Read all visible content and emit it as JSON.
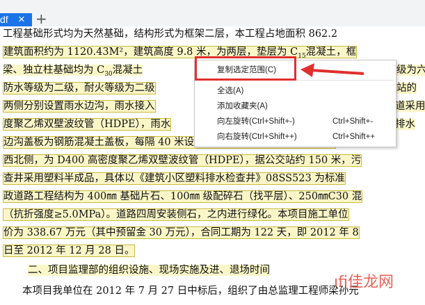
{
  "tab": {
    "label": "df",
    "close": "×",
    "new": "+"
  },
  "document": {
    "lines": [
      "工程基础形式均为天然基础，结构形式为框架二层，本工程占地面积 862.2",
      "建筑面积约为 1120.43M²，建筑高度 9.8 米，为两层，垫层为 C",
      "梁、独立柱基础均为 C",
      "防水等级为二级，耐火等级为二级",
      "两侧分别设置雨水边沟，雨水接入",
      "度聚乙烯双壁波纹管（HDPE），雨水",
      "边沟盖板为钢筋混凝土盖板，每隔 40 米设置伸缩缝一道；污水管道设置在",
      "西北侧，为 D400 高密度聚乙烯双壁波纹管（HDPE），据公交站约 150 米，污",
      "查井采用塑料半成品，具体以《建筑小区塑料排水检查井》08SS523 为标准",
      "政道路工程结构为 400㎜ 基础片石、100㎜ 级配碎石（找平层）、250㎜C30 混",
      "（抗折强度≥5.0MPa）。道路四周安装侧石，之内进行绿化。本项目施工单位",
      "价为 338.67 万元（其中预留金 30 万元），合同工期为 122 天，即 2012 年 8",
      "日至 2012 年 12 月 28 日。",
      "二、项目监理部的组织设施、现场实施及进、退场时间",
      "本项目我单位在 2012 年 7 月 27 日中标后，组织了由总监理工程师梁孙元"
    ],
    "fragments": {
      "sub15": "15",
      "tail1": "混凝土，框",
      "sub30": "30",
      "tail2": "混凝土",
      "tail2b": "级为六",
      "tail3": "站的",
      "tail4": "道采用",
      "tail5": "排水"
    }
  },
  "context_menu": {
    "items": [
      {
        "label": "复制选定范围(C)",
        "shortcut": ""
      },
      {
        "label": "全选(A)",
        "shortcut": ""
      },
      {
        "label": "添加收藏夹(A)",
        "shortcut": ""
      },
      {
        "label": "向左旋转(Ctrl+Shift+-)",
        "shortcut": "Ctrl+Shift+-"
      },
      {
        "label": "向右旋转(Ctrl+Shift++)",
        "shortcut": "Ctrl+Shift++"
      }
    ]
  },
  "annotation": {
    "color": "#e0302e"
  },
  "watermark": "ıfi佳龙网"
}
